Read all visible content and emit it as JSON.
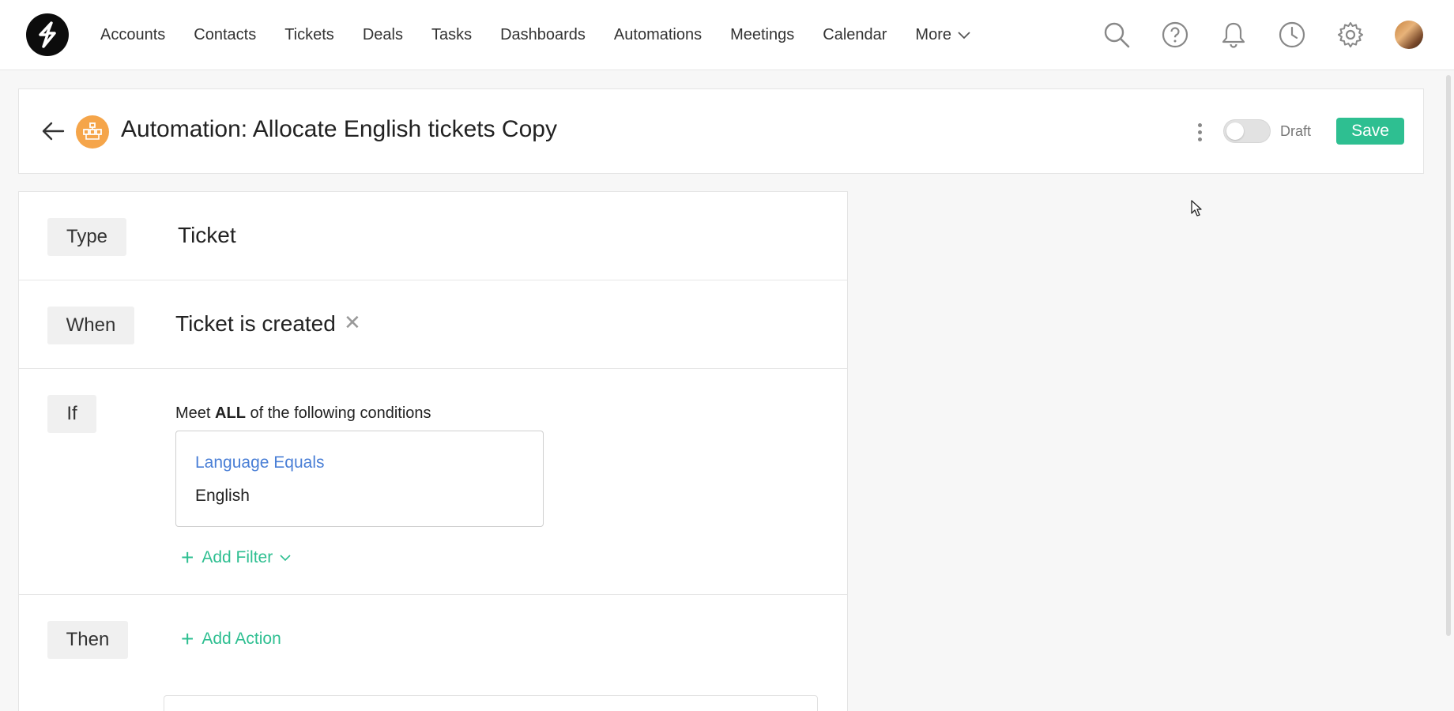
{
  "nav": {
    "items": [
      "Accounts",
      "Contacts",
      "Tickets",
      "Deals",
      "Tasks",
      "Dashboards",
      "Automations",
      "Meetings",
      "Calendar"
    ],
    "more_label": "More"
  },
  "header": {
    "title": "Automation: Allocate English tickets Copy",
    "status_label": "Draft",
    "save_label": "Save"
  },
  "sections": {
    "type": {
      "label": "Type",
      "value": "Ticket"
    },
    "when": {
      "label": "When",
      "value": "Ticket is created"
    },
    "if": {
      "label": "If",
      "prefix": "Meet",
      "match": "ALL",
      "suffix": "of the following conditions",
      "condition_field": "Language Equals",
      "condition_value": "English",
      "add_filter_label": "Add Filter"
    },
    "then": {
      "label": "Then",
      "add_action_label": "Add Action"
    }
  },
  "colors": {
    "accent": "#2ebf91",
    "link": "#4a7fd6",
    "automation_icon": "#f5a54a"
  }
}
